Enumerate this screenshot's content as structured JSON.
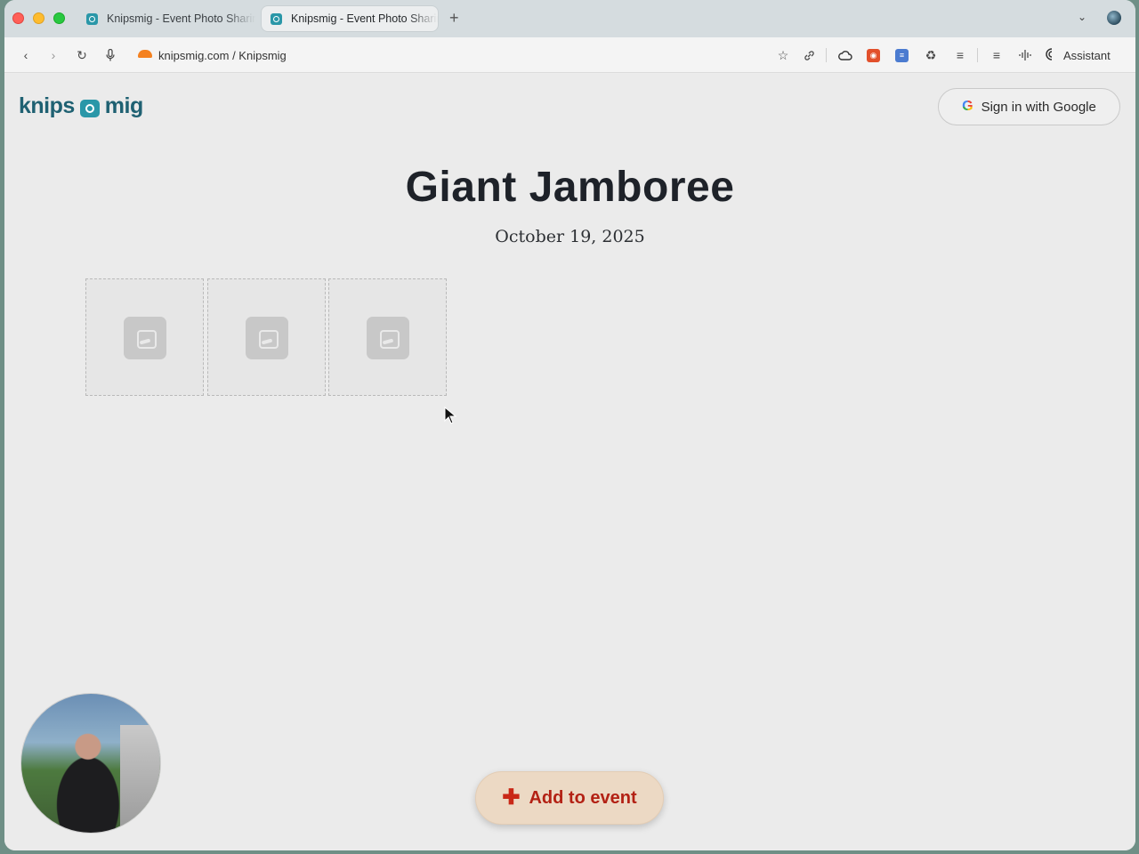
{
  "browser": {
    "tabs": [
      {
        "label": "Knipsmig - Event Photo Sharing",
        "active": false
      },
      {
        "label": "Knipsmig - Event Photo Sharing",
        "active": true
      }
    ],
    "url": "knipsmig.com / Knipsmig",
    "assistant_label": "Assistant"
  },
  "header": {
    "logo_left": "knips",
    "logo_right": "mig",
    "signin_label": "Sign in with Google"
  },
  "event": {
    "title": "Giant Jamboree",
    "date": "October 19, 2025"
  },
  "photo_tiles": [
    {
      "state": "placeholder"
    },
    {
      "state": "placeholder"
    },
    {
      "state": "placeholder"
    }
  ],
  "actions": {
    "add_label": "Add to event"
  },
  "colors": {
    "brand": "#1f6172",
    "accent": "#b32114",
    "add_button_bg": "#ecd9c4"
  }
}
